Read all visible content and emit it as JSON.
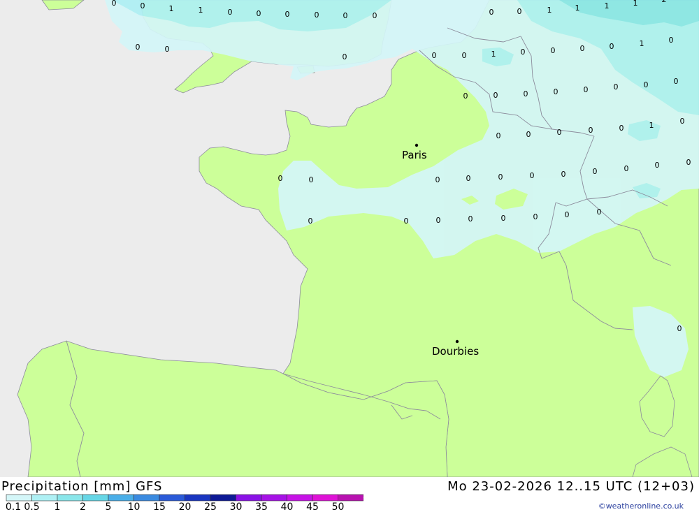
{
  "colors": {
    "sea": "#ececec",
    "land": "#ccff99",
    "precip_light": "#d4f6f8",
    "precip_medium": "#aef0f4",
    "precip_heavy": "#8ae6ea",
    "border": "#8c8c9c",
    "credit": "#2a3f9e"
  },
  "title": {
    "left": "Precipitation [mm] GFS",
    "right": "Mo 23-02-2026 12..15 UTC (12+03)"
  },
  "credit": "©weatheronline.co.uk",
  "legend": {
    "labels": [
      "0.1",
      "0.5",
      "1",
      "2",
      "5",
      "10",
      "15",
      "20",
      "25",
      "30",
      "35",
      "40",
      "45",
      "50"
    ],
    "colors": [
      "#d4f6f8",
      "#aef0f4",
      "#8ae6ea",
      "#66d6e6",
      "#4aaee8",
      "#3a8ae0",
      "#2a5ad8",
      "#1a36c0",
      "#0e1a96",
      "#8a12e6",
      "#a612e6",
      "#c612e6",
      "#de12d6",
      "#b812b0"
    ]
  },
  "cities": [
    {
      "name": "Paris"
    },
    {
      "name": "Dourbies"
    }
  ],
  "values": [
    {
      "v": "0"
    },
    {
      "v": "0"
    },
    {
      "v": "1"
    },
    {
      "v": "1"
    },
    {
      "v": "0"
    },
    {
      "v": "0"
    },
    {
      "v": "0"
    },
    {
      "v": "0"
    },
    {
      "v": "0"
    },
    {
      "v": "0"
    },
    {
      "v": "0"
    },
    {
      "v": "0"
    },
    {
      "v": "0"
    },
    {
      "v": "0"
    },
    {
      "v": "0"
    },
    {
      "v": "1"
    },
    {
      "v": "1"
    },
    {
      "v": "1"
    },
    {
      "v": "1"
    },
    {
      "v": "2"
    },
    {
      "v": "0"
    },
    {
      "v": "0"
    },
    {
      "v": "1"
    },
    {
      "v": "0"
    },
    {
      "v": "0"
    },
    {
      "v": "0"
    },
    {
      "v": "0"
    },
    {
      "v": "1"
    },
    {
      "v": "0"
    },
    {
      "v": "0"
    },
    {
      "v": "0"
    },
    {
      "v": "0"
    },
    {
      "v": "0"
    },
    {
      "v": "0"
    },
    {
      "v": "0"
    },
    {
      "v": "0"
    },
    {
      "v": "0"
    },
    {
      "v": "0"
    },
    {
      "v": "0"
    },
    {
      "v": "0"
    },
    {
      "v": "0"
    },
    {
      "v": "0"
    },
    {
      "v": "1"
    },
    {
      "v": "0"
    },
    {
      "v": "0"
    },
    {
      "v": "0"
    },
    {
      "v": "0"
    },
    {
      "v": "0"
    },
    {
      "v": "0"
    },
    {
      "v": "0"
    },
    {
      "v": "0"
    },
    {
      "v": "0"
    },
    {
      "v": "0"
    },
    {
      "v": "0"
    },
    {
      "v": "0"
    },
    {
      "v": "0"
    },
    {
      "v": "0"
    },
    {
      "v": "0"
    },
    {
      "v": "0"
    },
    {
      "v": "0"
    },
    {
      "v": "0"
    },
    {
      "v": "0"
    },
    {
      "v": "0"
    },
    {
      "v": "0"
    }
  ]
}
